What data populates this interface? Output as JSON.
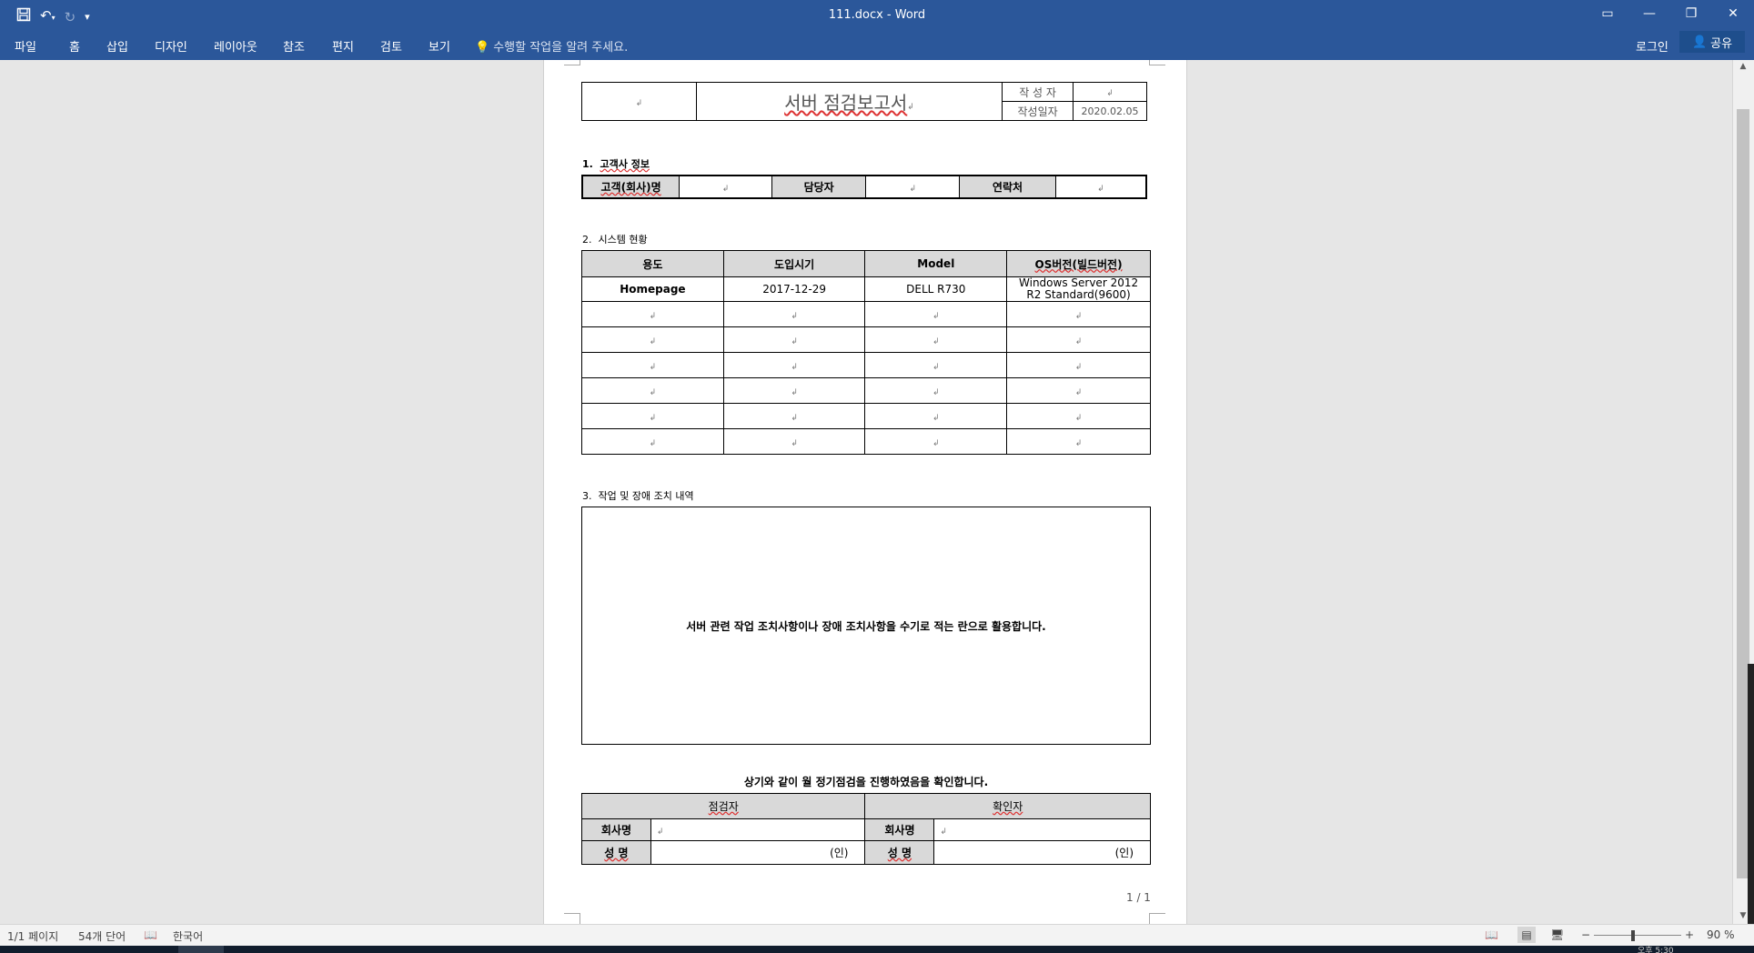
{
  "window": {
    "title": "111.docx - Word"
  },
  "qat": {
    "save_icon": "save-icon",
    "undo_icon": "undo-icon",
    "redo_icon": "redo-icon",
    "customize_icon": "customize-qat-icon"
  },
  "ribbon": {
    "tabs": [
      "파일",
      "홈",
      "삽입",
      "디자인",
      "레이아웃",
      "참조",
      "편지",
      "검토",
      "보기"
    ],
    "tell_me": "수행할 작업을 알려 주세요.",
    "login": "로그인",
    "share": "공유"
  },
  "document": {
    "header": {
      "title": "서버 점검보고서",
      "author_label": "작 성 자",
      "date_label": "작성일자",
      "date_value": "2020.02.05"
    },
    "section1": {
      "heading_num": "1.",
      "heading": "고객사 정보",
      "company_label": "고객(회사)명",
      "manager_label": "담당자",
      "contact_label": "연락처"
    },
    "section2": {
      "heading_num": "2.",
      "heading": "시스템 현황",
      "columns": [
        "용도",
        "도입시기",
        "Model",
        "OS버전(빌드버전)"
      ],
      "row1": {
        "use": "Homepage",
        "date": "2017-12-29",
        "model": "DELL R730",
        "os_line1": "Windows Server 2012",
        "os_line2": "R2 Standard(9600)"
      }
    },
    "section3": {
      "heading_num": "3.",
      "heading": "작업 및 장애 조치 내역",
      "body": "서버 관련 작업 조치사항이나 장애 조치사항을 수기로 적는 란으로 활용합니다."
    },
    "confirm": {
      "statement": "상기와 같이 월 정기점검을 진행하였음을 확인합니다.",
      "inspector": "점검자",
      "approver": "확인자",
      "company_label": "회사명",
      "name_label": "성 명",
      "seal": "(인)"
    },
    "page_number": "1 / 1"
  },
  "status": {
    "page": "1/1 페이지",
    "words": "54개 단어",
    "language": "한국어",
    "zoom": "90 %",
    "zoom_level": 0.9
  },
  "taskbar": {
    "clock": "오후 5:30"
  }
}
